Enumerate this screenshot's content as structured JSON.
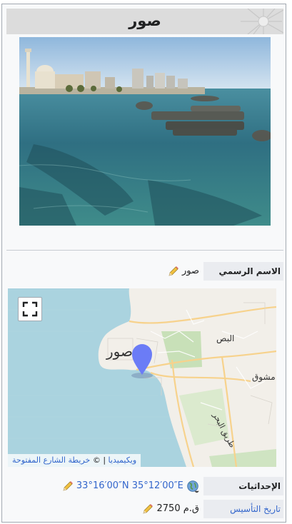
{
  "infobox": {
    "title": "صور",
    "official_name_label": "الاسم الرسمي",
    "official_name_value": "صور",
    "coordinates_label": "الإحداثيات",
    "coordinates_value": "33°16′00″N 35°12′00″E",
    "founded_label": "تاريخ التأسيس",
    "founded_value": "2750 ق.م"
  },
  "map": {
    "city_label": "صور",
    "al_bass_label": "البص",
    "mashouq_label": "مشوق",
    "road_label": "طريق البحر",
    "attribution_wiki": "ويكيميديا",
    "attribution_sep": " | © ",
    "attribution_osm": "خريطة الشارع المفتوحة",
    "marker_color": "#6b7cf6",
    "sea_color": "#aad3df",
    "land_color": "#f2efe9"
  },
  "icons": {
    "pencil": "pencil-icon",
    "globe": "globe-icon",
    "fullscreen": "fullscreen-icon",
    "marker": "map-marker-icon"
  }
}
